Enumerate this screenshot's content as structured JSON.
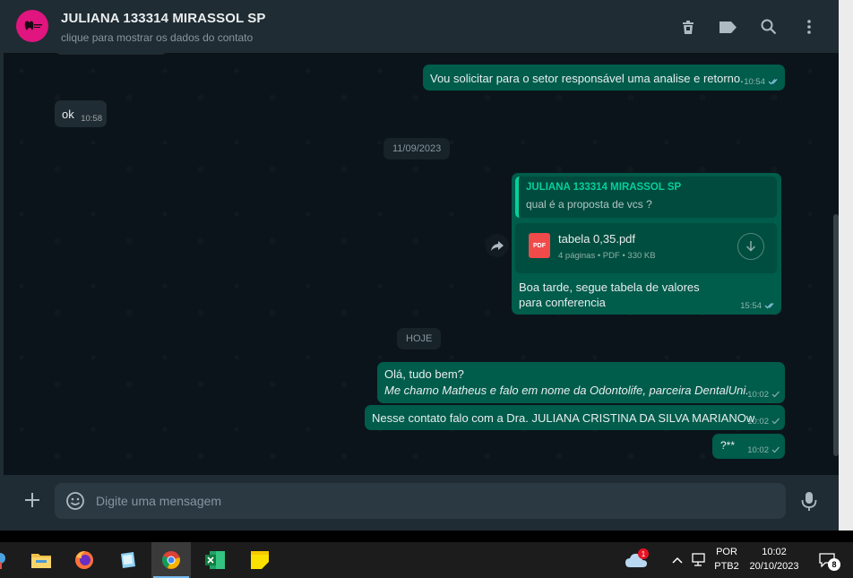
{
  "header": {
    "contact_name": "JULIANA 133314 MIRASSOL SP",
    "contact_subtitle": "clique para mostrar os dados do contato",
    "icons": [
      "trash-icon",
      "label-icon",
      "search-icon",
      "menu-icon"
    ]
  },
  "messages": [
    {
      "direction": "out",
      "text": "Vou solicitar para o setor responsável uma analise e retorno.",
      "time": "10:54",
      "status": "read"
    },
    {
      "direction": "in",
      "text": "ok",
      "time": "10:58"
    },
    {
      "type": "date",
      "text": "11/09/2023"
    },
    {
      "direction": "out",
      "quote_author": "JULIANA 133314 MIRASSOL SP",
      "quote_text": "qual é a proposta de vcs ?",
      "file_name": "tabela 0,35.pdf",
      "file_meta": "4 páginas • PDF • 330 KB",
      "file_badge": "PDF",
      "text": "Boa tarde, segue tabela de valores para conferencia",
      "time": "15:54",
      "status": "read"
    },
    {
      "type": "date",
      "text": "HOJE"
    },
    {
      "direction": "out",
      "line1": "Olá, tudo bem?",
      "line2": "Me chamo Matheus e falo em nome da Odontolife, parceira DentalUni.",
      "time": "10:02",
      "status": "sent"
    },
    {
      "direction": "out",
      "text": "Nesse contato falo com a Dra. JULIANA CRISTINA DA SILVA MARIANOw",
      "time": "10:02",
      "status": "sent"
    },
    {
      "direction": "out",
      "text": "?**",
      "time": "10:02",
      "status": "sent"
    }
  ],
  "composer": {
    "placeholder": "Digite uma mensagem"
  },
  "taskbar": {
    "notification_badge": "1",
    "language": "POR",
    "layout": "PTB2",
    "clock_time": "10:02",
    "clock_date": "20/10/2023",
    "notifications_count": "8"
  },
  "colors": {
    "outgoing": "#005c4b",
    "incoming": "#202c33",
    "accent": "#06cf9c",
    "background": "#0b141a"
  }
}
